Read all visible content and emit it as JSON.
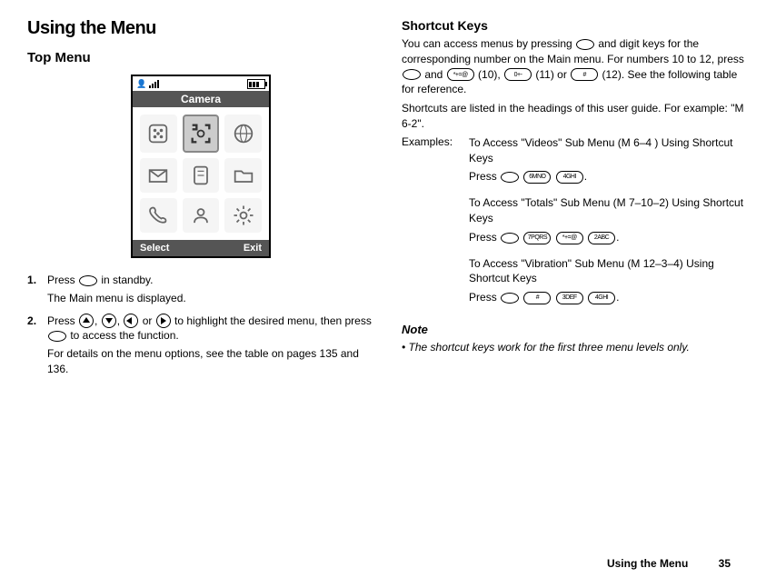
{
  "page": {
    "title": "Using the Menu",
    "footer_text": "Using the Menu",
    "page_number": "35"
  },
  "left": {
    "section_title": "Top Menu",
    "phone": {
      "menu_title": "Camera",
      "softkey_left": "Select",
      "softkey_right": "Exit"
    },
    "steps": [
      {
        "text_before": "Press ",
        "text_after": " in standby.",
        "sub": "The Main menu is displayed."
      },
      {
        "text_before": "Press ",
        "text_mid1": ", ",
        "text_mid2": ", ",
        "text_mid3": " or ",
        "text_mid4": " to highlight the desired menu, then press ",
        "text_after": " to access the function.",
        "sub": "For details on the menu options, see the table on pages 135 and 136."
      }
    ]
  },
  "right": {
    "section_title": "Shortcut Keys",
    "para1_a": "You can access menus by pressing ",
    "para1_b": " and digit keys for the corresponding number on the Main menu. For numbers 10 to 12, press ",
    "para1_c": " and ",
    "para1_d": " (10), ",
    "para1_e": " (11) or ",
    "para1_f": " (12). See the following table for reference.",
    "para2": "Shortcuts are listed in the headings of this user guide. For example: \"M 6-2\".",
    "examples_label": "Examples:",
    "examples": [
      {
        "title": "To Access \"Videos\" Sub Menu (M 6–4 ) Using Shortcut Keys",
        "press_label": "Press ",
        "keys": [
          "6MNO",
          "4GHI"
        ],
        "end": "."
      },
      {
        "title": "To Access \"Totals\" Sub Menu (M 7–10–2) Using Shortcut Keys",
        "press_label": "Press ",
        "keys": [
          "7PQRS",
          "*+=@",
          "2ABC"
        ],
        "end": "."
      },
      {
        "title": "To Access \"Vibration\" Sub Menu (M 12–3–4) Using Shortcut Keys",
        "press_label": "Press ",
        "keys": [
          "#",
          "3DEF",
          "4GHI"
        ],
        "end": "."
      }
    ],
    "note_label": "Note",
    "note_item": "The shortcut keys work for the first three menu levels only."
  },
  "key_labels": {
    "star": "*+=@",
    "zero": "0+-",
    "hash": "#"
  }
}
